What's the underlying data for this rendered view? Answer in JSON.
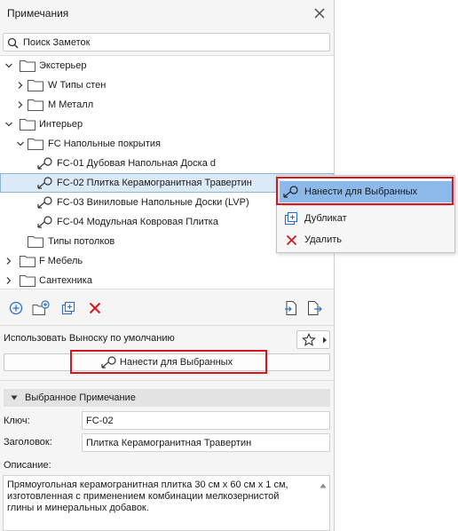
{
  "panel": {
    "title": "Примечания"
  },
  "search": {
    "placeholder": "Поиск Заметок"
  },
  "tree": {
    "items": [
      {
        "label": "Экстерьер"
      },
      {
        "label": "W Типы стен"
      },
      {
        "label": "M Металл"
      },
      {
        "label": "Интерьер"
      },
      {
        "label": "FC Напольные покрытия"
      },
      {
        "label": "FC-01 Дубовая Напольная Доска d"
      },
      {
        "label": "FC-02 Плитка Керамогранитная Травертин",
        "selected": true
      },
      {
        "label": "FC-03 Виниловые Напольные Доски (LVP)"
      },
      {
        "label": "FC-04 Модульная Ковровая Плитка"
      },
      {
        "label": "Типы потолков"
      },
      {
        "label": "F Мебель"
      },
      {
        "label": "Сантехника"
      }
    ]
  },
  "context_menu": {
    "items": [
      {
        "label": "Нанести для Выбранных",
        "icon": "apply-callout-icon"
      },
      {
        "label": "Дубликат",
        "icon": "duplicate-icon"
      },
      {
        "label": "Удалить",
        "icon": "delete-x-icon"
      }
    ]
  },
  "callout": {
    "label": "Использовать Выноску по умолчанию",
    "apply_label": "Нанести для Выбранных"
  },
  "selected_note": {
    "section_title": "Выбранное Примечание",
    "key_label": "Ключ:",
    "key_value": "FC-02",
    "title_label": "Заголовок:",
    "title_value": "Плитка Керамогранитная Травертин",
    "description_label": "Описание:",
    "description_value": "Прямоугольная керамогранитная плитка 30 см x 60 см x 1 см,\nизготовленная с применением комбинации мелкозернистой\nглины и минеральных добавок."
  },
  "colors": {
    "accent": "#2a6fc9",
    "highlight": "#8cb9ea",
    "selection": "#dce9f7",
    "danger": "#d6161c"
  }
}
